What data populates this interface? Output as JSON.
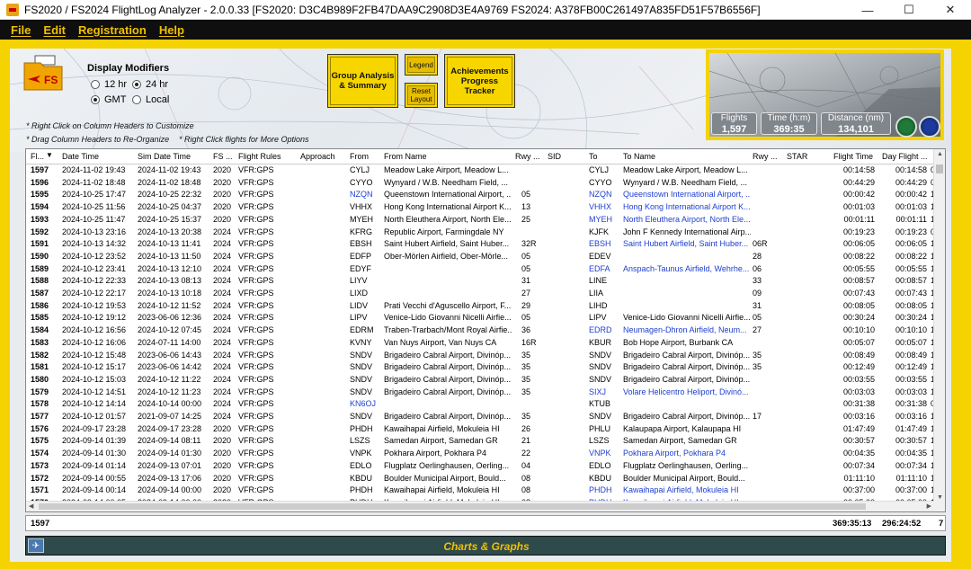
{
  "window": {
    "title": "FS2020 / FS2024 FlightLog Analyzer - 2.0.0.33     [FS2020: D3C4B989F2FB47DAA9C2908D3E4A9769     FS2024: A378FB00C261497A835FD51F57B6556F]",
    "minimize": "—",
    "maximize": "☐",
    "close": "✕"
  },
  "menu": [
    "File",
    "Edit",
    "Registration",
    "Help"
  ],
  "display_modifiers": {
    "title": "Display Modifiers",
    "opt_12hr": "12 hr",
    "opt_24hr": "24 hr",
    "opt_gmt": "GMT",
    "opt_local": "Local",
    "selected_hours": "24 hr",
    "selected_zone": "GMT"
  },
  "buttons": {
    "group_analysis": "Group Analysis & Summary",
    "legend": "Legend",
    "reset_layout": "Reset Layout",
    "achievements": "Achievements Progress Tracker"
  },
  "hints": {
    "h1": "* Right Click on Column Headers to Customize",
    "h2": "* Drag Column Headers to Re-Organize",
    "h3": "* Right Click flights for More Options"
  },
  "stats": {
    "flights_label": "Flights",
    "flights_value": "1,597",
    "time_label": "Time (h:m)",
    "time_value": "369:35",
    "distance_label": "Distance (nm)",
    "distance_value": "134,101"
  },
  "columns": [
    "Fl...",
    "Date Time",
    "Sim Date Time",
    "FS ...",
    "Flight Rules",
    "Approach",
    "From",
    "From Name",
    "Rwy ...",
    "SID",
    "To",
    "To Name",
    "Rwy ...",
    "STAR",
    "Flight Time",
    "Day Flight ..."
  ],
  "rows": [
    [
      "1597",
      "2024-11-02 19:43",
      "2024-11-02 19:43",
      "2020",
      "VFR:GPS",
      "",
      "CYLJ",
      "Meadow Lake Airport,  Meadow L...",
      "",
      "",
      "CYLJ",
      "Meadow Lake Airport,  Meadow L...",
      "",
      "",
      "00:14:58",
      "00:14:58",
      "0"
    ],
    [
      "1596",
      "2024-11-02 18:48",
      "2024-11-02 18:48",
      "2020",
      "VFR:GPS",
      "",
      "CYYO",
      "Wynyard / W.B. Needham Field, ...",
      "",
      "",
      "CYYO",
      "Wynyard / W.B. Needham Field, ...",
      "",
      "",
      "00:44:29",
      "00:44:29",
      "0"
    ],
    [
      "1595",
      "2024-10-25 17:47",
      "2024-10-25 22:32",
      "2020",
      "VFR:GPS",
      "",
      "NZQN",
      "Queenstown International Airport, ...",
      "05",
      "",
      "NZQN",
      "Queenstown International Airport, ...",
      "",
      "",
      "00:00:42",
      "00:00:42",
      "1"
    ],
    [
      "1594",
      "2024-10-25 11:56",
      "2024-10-25 04:37",
      "2020",
      "VFR:GPS",
      "",
      "VHHX",
      "Hong Kong International Airport K...",
      "13",
      "",
      "VHHX",
      "Hong Kong International Airport K...",
      "",
      "",
      "00:01:03",
      "00:01:03",
      "1"
    ],
    [
      "1593",
      "2024-10-25 11:47",
      "2024-10-25 15:37",
      "2020",
      "VFR:GPS",
      "",
      "MYEH",
      "North Eleuthera Airport,  North Ele...",
      "25",
      "",
      "MYEH",
      "North Eleuthera Airport,  North Ele...",
      "",
      "",
      "00:01:11",
      "00:01:11",
      "1"
    ],
    [
      "1592",
      "2024-10-13 23:16",
      "2024-10-13 20:38",
      "2024",
      "VFR:GPS",
      "",
      "KFRG",
      "Republic Airport,  Farmingdale NY",
      "",
      "",
      "KJFK",
      "John F Kennedy International Airp...",
      "",
      "",
      "00:19:23",
      "00:19:23",
      "0"
    ],
    [
      "1591",
      "2024-10-13 14:32",
      "2024-10-13 11:41",
      "2024",
      "VFR:GPS",
      "",
      "EBSH",
      "Saint Hubert Airfield,  Saint Huber...",
      "32R",
      "",
      "EBSH",
      "Saint Hubert Airfield,  Saint Huber...",
      "06R",
      "",
      "00:06:05",
      "00:06:05",
      "1"
    ],
    [
      "1590",
      "2024-10-12 23:52",
      "2024-10-13 11:50",
      "2024",
      "VFR:GPS",
      "",
      "EDFP",
      "Ober-Mörlen Airfield,  Ober-Mörle...",
      "05",
      "",
      "EDEV",
      "",
      "28",
      "",
      "00:08:22",
      "00:08:22",
      "1"
    ],
    [
      "1589",
      "2024-10-12 23:41",
      "2024-10-13 12:10",
      "2024",
      "VFR:GPS",
      "",
      "EDYF",
      "",
      "05",
      "",
      "EDFA",
      "Anspach-Taunus Airfield,  Wehrhe...",
      "06",
      "",
      "00:05:55",
      "00:05:55",
      "1"
    ],
    [
      "1588",
      "2024-10-12 22:33",
      "2024-10-13 08:13",
      "2024",
      "VFR:GPS",
      "",
      "LIYV",
      "",
      "31",
      "",
      "LINE",
      "",
      "33",
      "",
      "00:08:57",
      "00:08:57",
      "1"
    ],
    [
      "1587",
      "2024-10-12 22:17",
      "2024-10-13 10:18",
      "2024",
      "VFR:GPS",
      "",
      "LIXD",
      "",
      "27",
      "",
      "LIIA",
      "",
      "09",
      "",
      "00:07:43",
      "00:07:43",
      "1"
    ],
    [
      "1586",
      "2024-10-12 19:53",
      "2024-10-12 11:52",
      "2024",
      "VFR:GPS",
      "",
      "LIDV",
      "Prati Vecchi d'Aguscello Airport,  F...",
      "29",
      "",
      "LIHD",
      "",
      "31",
      "",
      "00:08:05",
      "00:08:05",
      "1"
    ],
    [
      "1585",
      "2024-10-12 19:12",
      "2023-06-06 12:36",
      "2024",
      "VFR:GPS",
      "",
      "LIPV",
      "Venice-Lido Giovanni Nicelli Airfie...",
      "05",
      "",
      "LIPV",
      "Venice-Lido Giovanni Nicelli Airfie...",
      "05",
      "",
      "00:30:24",
      "00:30:24",
      "1"
    ],
    [
      "1584",
      "2024-10-12 16:56",
      "2024-10-12 07:45",
      "2024",
      "VFR:GPS",
      "",
      "EDRM",
      "Traben-Trarbach/Mont Royal Airfie...",
      "36",
      "",
      "EDRD",
      "Neumagen-Dhron Airfield,  Neum...",
      "27",
      "",
      "00:10:10",
      "00:10:10",
      "1"
    ],
    [
      "1583",
      "2024-10-12 16:06",
      "2024-07-11 14:00",
      "2024",
      "VFR:GPS",
      "",
      "KVNY",
      "Van Nuys Airport,  Van Nuys CA",
      "16R",
      "",
      "KBUR",
      "Bob Hope Airport,  Burbank CA",
      "",
      "",
      "00:05:07",
      "00:05:07",
      "1"
    ],
    [
      "1582",
      "2024-10-12 15:48",
      "2023-06-06 14:43",
      "2024",
      "VFR:GPS",
      "",
      "SNDV",
      "Brigadeiro Cabral Airport,  Divinóp...",
      "35",
      "",
      "SNDV",
      "Brigadeiro Cabral Airport,  Divinóp...",
      "35",
      "",
      "00:08:49",
      "00:08:49",
      "1"
    ],
    [
      "1581",
      "2024-10-12 15:17",
      "2023-06-06 14:42",
      "2024",
      "VFR:GPS",
      "",
      "SNDV",
      "Brigadeiro Cabral Airport,  Divinóp...",
      "35",
      "",
      "SNDV",
      "Brigadeiro Cabral Airport,  Divinóp...",
      "35",
      "",
      "00:12:49",
      "00:12:49",
      "1"
    ],
    [
      "1580",
      "2024-10-12 15:03",
      "2024-10-12 11:22",
      "2024",
      "VFR:GPS",
      "",
      "SNDV",
      "Brigadeiro Cabral Airport,  Divinóp...",
      "35",
      "",
      "SNDV",
      "Brigadeiro Cabral Airport,  Divinóp...",
      "",
      "",
      "00:03:55",
      "00:03:55",
      "1"
    ],
    [
      "1579",
      "2024-10-12 14:51",
      "2024-10-12 11:23",
      "2024",
      "VFR:GPS",
      "",
      "SNDV",
      "Brigadeiro Cabral Airport,  Divinóp...",
      "35",
      "",
      "SIXJ",
      "Volare Helicentro Heliport,  Divinó...",
      "",
      "",
      "00:03:03",
      "00:03:03",
      "1"
    ],
    [
      "1578",
      "2024-10-12 14:14",
      "2024-10-14 00:00",
      "2024",
      "VFR:GPS",
      "",
      "KN6OJ",
      "",
      "",
      "",
      "KTUB",
      "",
      "",
      "",
      "00:31:38",
      "00:31:38",
      "0"
    ],
    [
      "1577",
      "2024-10-12 01:57",
      "2021-09-07 14:25",
      "2024",
      "VFR:GPS",
      "",
      "SNDV",
      "Brigadeiro Cabral Airport,  Divinóp...",
      "35",
      "",
      "SNDV",
      "Brigadeiro Cabral Airport,  Divinóp...",
      "17",
      "",
      "00:03:16",
      "00:03:16",
      "1"
    ],
    [
      "1576",
      "2024-09-17 23:28",
      "2024-09-17 23:28",
      "2020",
      "VFR:GPS",
      "",
      "PHDH",
      "Kawaihapai Airfield,  Mokuleia HI",
      "26",
      "",
      "PHLU",
      "Kalaupapa Airport,  Kalaupapa HI",
      "",
      "",
      "01:47:49",
      "01:47:49",
      "1"
    ],
    [
      "1575",
      "2024-09-14 01:39",
      "2024-09-14 08:11",
      "2020",
      "VFR:GPS",
      "",
      "LSZS",
      "Samedan Airport,  Samedan GR",
      "21",
      "",
      "LSZS",
      "Samedan Airport,  Samedan GR",
      "",
      "",
      "00:30:57",
      "00:30:57",
      "1"
    ],
    [
      "1574",
      "2024-09-14 01:30",
      "2024-09-14 01:30",
      "2020",
      "VFR:GPS",
      "",
      "VNPK",
      "Pokhara Airport,  Pokhara P4",
      "22",
      "",
      "VNPK",
      "Pokhara Airport,  Pokhara P4",
      "",
      "",
      "00:04:35",
      "00:04:35",
      "1"
    ],
    [
      "1573",
      "2024-09-14 01:14",
      "2024-09-13 07:01",
      "2020",
      "VFR:GPS",
      "",
      "EDLO",
      "Flugplatz Oerlinghausen,  Oerling...",
      "04",
      "",
      "EDLO",
      "Flugplatz Oerlinghausen,  Oerling...",
      "",
      "",
      "00:07:34",
      "00:07:34",
      "1"
    ],
    [
      "1572",
      "2024-09-14 00:55",
      "2024-09-13 17:06",
      "2020",
      "VFR:GPS",
      "",
      "KBDU",
      "Boulder Municipal Airport,  Bould...",
      "08",
      "",
      "KBDU",
      "Boulder Municipal Airport,  Bould...",
      "",
      "",
      "01:11:10",
      "01:11:10",
      "1"
    ],
    [
      "1571",
      "2024-09-14 00:14",
      "2024-09-14 00:00",
      "2020",
      "VFR:GPS",
      "",
      "PHDH",
      "Kawaihapai Airfield,  Mokuleia HI",
      "08",
      "",
      "PHDH",
      "Kawaihapai Airfield,  Mokuleia HI",
      "",
      "",
      "00:37:00",
      "00:37:00",
      "1"
    ],
    [
      "1570",
      "2024-09-14 00:05",
      "2024-09-14 00:00",
      "2020",
      "VFR:GPS",
      "",
      "PHDH",
      "Kawaihapai Airfield,  Mokuleia HI",
      "08",
      "",
      "PHDH",
      "Kawaihapai Airfield,  Mokuleia HI",
      "",
      "",
      "00:05:00",
      "00:05:00",
      "1"
    ]
  ],
  "blue_to": [
    "1595",
    "1594",
    "1593",
    "1591",
    "1589",
    "1584",
    "1579",
    "1574",
    "1571",
    "1570"
  ],
  "blue_from": [
    "1595",
    "1578"
  ],
  "totals": {
    "count": "1597",
    "flight_time": "369:35:13",
    "day_time": "296:24:52",
    "extra": "7"
  },
  "charts_label": "Charts & Graphs",
  "colors": {
    "frame": "#f5d300",
    "menu_text": "#f0c000",
    "link_blue": "#1d3fd0",
    "charts_bar": "#2e4a4a"
  },
  "icons": [
    "app-icon",
    "logbook-logo-icon",
    "sort-desc-icon",
    "plane-icon",
    "compass-gauge-icon",
    "heading-gauge-icon"
  ]
}
